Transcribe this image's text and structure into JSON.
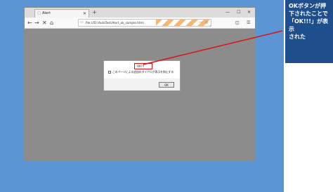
{
  "browser": {
    "tab_title": "Alert",
    "tab_close": "✕",
    "new_tab": "+",
    "window_controls": [
      "—",
      "☐",
      "✕"
    ],
    "url": "file:///D:/AutoTest/Alert_ok_sample.html",
    "url_dots": "···",
    "nav": {
      "back": "←",
      "forward": "→",
      "stop": "✕",
      "home": "⌂"
    },
    "toolbar_icons": [
      "◫",
      "☰"
    ]
  },
  "dialog": {
    "message": "OK!!!",
    "checkbox_label": "このページによる追加のダイアログ表示を抑止する",
    "ok_label": "OK"
  },
  "callout": {
    "lines": [
      "OKボタンが押",
      "下されたことで",
      "「OK!!!」が表示",
      "された"
    ]
  },
  "colors": {
    "desktop": "#5b95d3",
    "page_content": "#8c8c8c",
    "callout_bg": "#1f4e8c",
    "highlight_red": "#dd1111"
  }
}
